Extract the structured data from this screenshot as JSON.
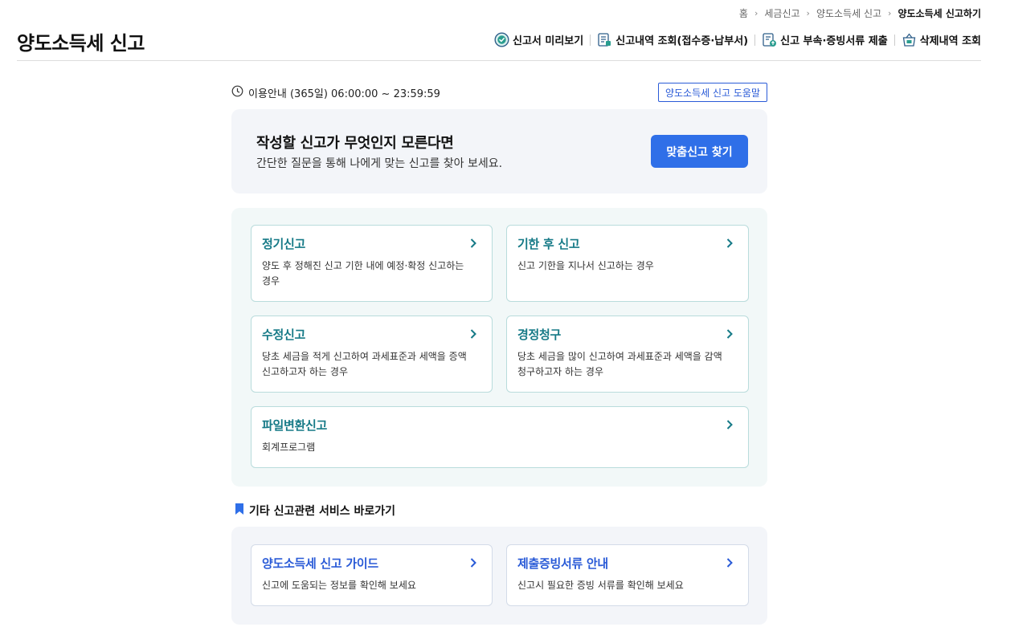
{
  "breadcrumb": [
    "홈",
    "세금신고",
    "양도소득세 신고",
    "양도소득세 신고하기"
  ],
  "page_title": "양도소득세 신고",
  "top_actions": [
    {
      "label": "신고서 미리보기",
      "icon": "check-circle-icon"
    },
    {
      "label": "신고내역 조회(접수증·납부서)",
      "icon": "document-list-icon"
    },
    {
      "label": "신고 부속·증빙서류 제출",
      "icon": "document-upload-icon"
    },
    {
      "label": "삭제내역 조회",
      "icon": "basket-icon"
    }
  ],
  "hours_text": "이용안내 (365일) 06:00:00 ~ 23:59:59",
  "help_button": "양도소득세 신고 도움말",
  "find": {
    "title": "작성할 신고가 무엇인지 모른다면",
    "subtitle": "간단한 질문을 통해 나에게 맞는 신고를 찾아 보세요.",
    "button": "맞춤신고 찾기"
  },
  "report_types": [
    {
      "title": "정기신고",
      "desc": "양도 후 정해진 신고 기한 내에 예정·확정 신고하는 경우"
    },
    {
      "title": "기한 후 신고",
      "desc": "신고 기한을 지나서 신고하는 경우"
    },
    {
      "title": "수정신고",
      "desc": "당초 세금을 적게 신고하여 과세표준과 세액을 증액 신고하고자 하는 경우"
    },
    {
      "title": "경정청구",
      "desc": "당초 세금을 많이 신고하여 과세표준과 세액을 감액 청구하고자 하는 경우"
    },
    {
      "title": "파일변환신고",
      "desc": "회계프로그램"
    }
  ],
  "other_services": {
    "heading": "기타 신고관련 서비스 바로가기",
    "items": [
      {
        "title": "양도소득세 신고 가이드",
        "desc": "신고에 도움되는 정보를 확인해 보세요"
      },
      {
        "title": "제출증빙서류 안내",
        "desc": "신고시 필요한 증빙 서류를 확인해 보세요"
      }
    ]
  },
  "colors": {
    "primary_button": "#2f6fe8",
    "teal_title": "#167a87",
    "blue_title": "#2a5bd7",
    "card_border_teal": "#b9dcdc"
  }
}
